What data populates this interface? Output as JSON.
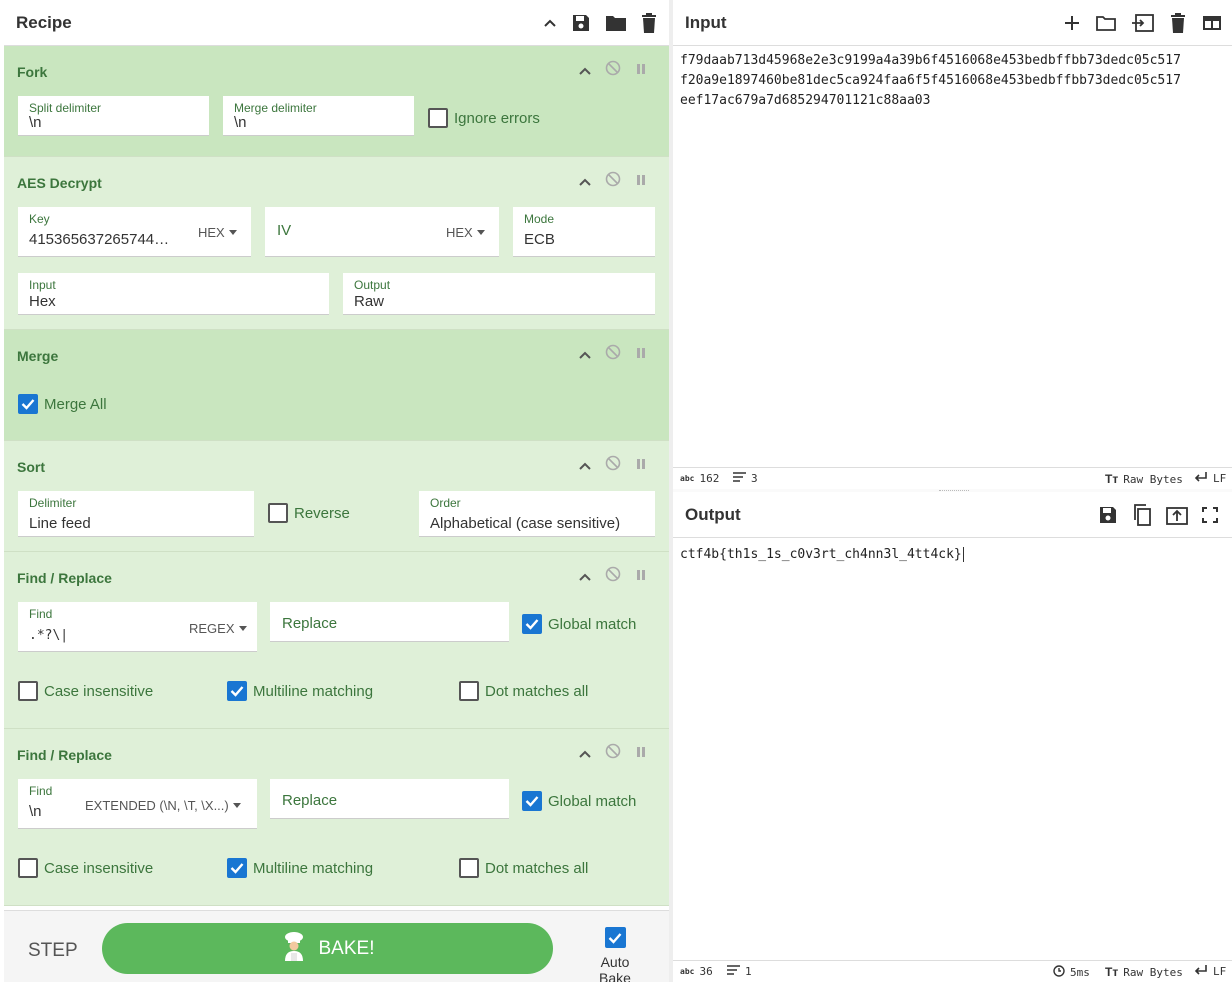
{
  "recipe": {
    "title": "Recipe",
    "operations": {
      "fork": {
        "title": "Fork",
        "split_label": "Split delimiter",
        "split_value": "\\n",
        "merge_label": "Merge delimiter",
        "merge_value": "\\n",
        "ignore_errors": "Ignore errors"
      },
      "aes": {
        "title": "AES Decrypt",
        "key_label": "Key",
        "key_value": "415365637265744…",
        "key_format": "HEX",
        "iv_placeholder": "IV",
        "iv_format": "HEX",
        "mode_label": "Mode",
        "mode_value": "ECB",
        "input_label": "Input",
        "input_value": "Hex",
        "output_label": "Output",
        "output_value": "Raw"
      },
      "merge": {
        "title": "Merge",
        "merge_all": "Merge All"
      },
      "sort": {
        "title": "Sort",
        "delim_label": "Delimiter",
        "delim_value": "Line feed",
        "reverse": "Reverse",
        "order_label": "Order",
        "order_value": "Alphabetical (case sensitive)"
      },
      "find1": {
        "title": "Find / Replace",
        "find_label": "Find",
        "find_value": ".*?\\|",
        "find_type": "REGEX",
        "replace_placeholder": "Replace",
        "global_match": "Global match",
        "case_insensitive": "Case insensitive",
        "multiline": "Multiline matching",
        "dot_all": "Dot matches all"
      },
      "find2": {
        "title": "Find / Replace",
        "find_label": "Find",
        "find_value": "\\n",
        "find_type": "EXTENDED (\\N, \\T, \\X...)",
        "replace_placeholder": "Replace",
        "global_match": "Global match",
        "case_insensitive": "Case insensitive",
        "multiline": "Multiline matching",
        "dot_all": "Dot matches all"
      }
    }
  },
  "controls": {
    "step": "STEP",
    "bake": "BAKE!",
    "auto_bake": "Auto Bake"
  },
  "input": {
    "title": "Input",
    "lines": [
      "f79daab713d45968e2e3c9199a4a39b6f4516068e453bedbffbb73dedc05c517",
      "f20a9e1897460be81dec5ca924faa6f5f4516068e453bedbffbb73dedc05c517",
      "eef17ac679a7d685294701121c88aa03"
    ],
    "status": {
      "chars_icon": "abc",
      "chars": "162",
      "lines": "3",
      "encoding": "Raw Bytes",
      "eol": "LF"
    }
  },
  "output": {
    "title": "Output",
    "text": "ctf4b{th1s_1s_c0v3rt_ch4nn3l_4tt4ck}",
    "status": {
      "chars_icon": "abc",
      "chars": "36",
      "lines": "1",
      "time": "5ms",
      "encoding": "Raw Bytes",
      "eol": "LF"
    }
  },
  "colors": {
    "accent": "#1976d2",
    "bake": "#5cb85c",
    "op_dark": "#c9e6bf",
    "op_light": "#dff0d8",
    "label": "#3c763d"
  }
}
